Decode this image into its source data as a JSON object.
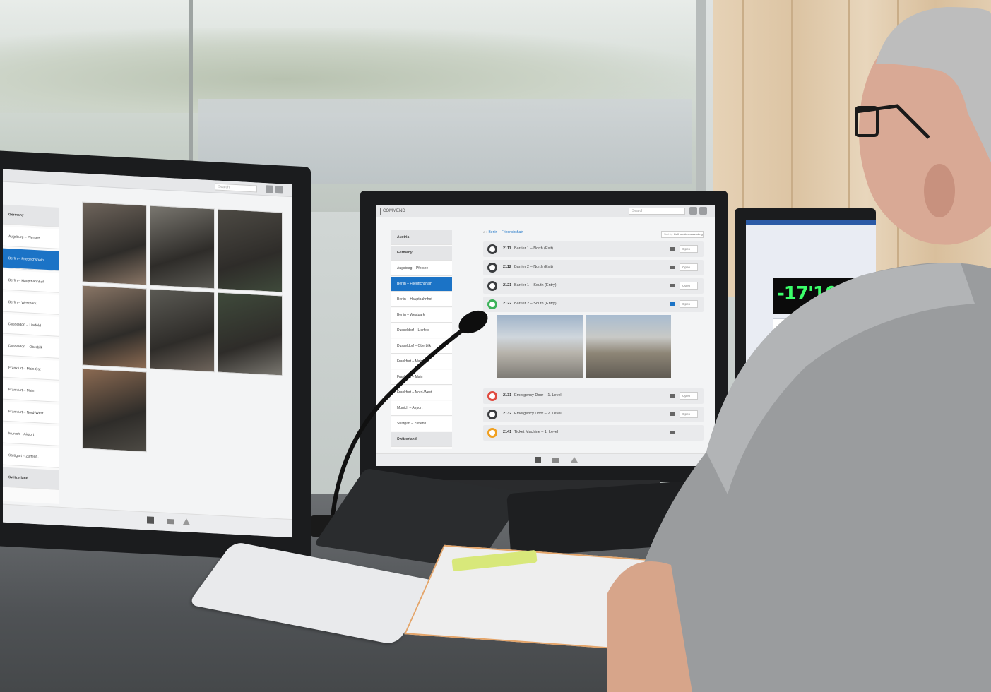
{
  "center_screen": {
    "logo": "COMMEND",
    "search_placeholder": "Search",
    "breadcrumb": "Berlin – Friedrichshain",
    "sort_label": "Sort by",
    "sort_value": "Call number ascending",
    "sidebar": [
      {
        "label": "Austria",
        "style": "hdr"
      },
      {
        "label": "Germany",
        "style": "hdr"
      },
      {
        "label": "Augsburg – Pfersee",
        "style": "normal"
      },
      {
        "label": "Berlin – Friedrichshain",
        "style": "active"
      },
      {
        "label": "Berlin – Hauptbahnhof",
        "style": "normal"
      },
      {
        "label": "Berlin – Westpark",
        "style": "normal"
      },
      {
        "label": "Dusseldorf – Lierfeld",
        "style": "normal"
      },
      {
        "label": "Dusseldorf – Oberbilk",
        "style": "normal"
      },
      {
        "label": "Frankfurt – Main Ost",
        "style": "normal"
      },
      {
        "label": "Frankfurt – Main",
        "style": "normal"
      },
      {
        "label": "Frankfurt – Nord-West",
        "style": "normal"
      },
      {
        "label": "Munich – Airport",
        "style": "normal"
      },
      {
        "label": "Stuttgart – Zuffenh.",
        "style": "normal"
      },
      {
        "label": "Switzerland",
        "style": "hdr"
      }
    ],
    "devices": [
      {
        "number": "2111",
        "label": "Barrier 1 – North (Exit)",
        "ring": "#3a3c3f",
        "select": "Open"
      },
      {
        "number": "2112",
        "label": "Barrier 2 – North (Exit)",
        "ring": "#3a3c3f",
        "select": "Open"
      },
      {
        "number": "2121",
        "label": "Barrier 1 – South (Entry)",
        "ring": "#3a3c3f",
        "select": "Open"
      },
      {
        "number": "2122",
        "label": "Barrier 2 – South (Entry)",
        "ring": "#3cb25a",
        "select": "Open"
      },
      {
        "number": "2131",
        "label": "Emergency Door – 1. Level",
        "ring": "#e04a3f",
        "select": "Open"
      },
      {
        "number": "2132",
        "label": "Emergency Door – 2. Level",
        "ring": "#3a3c3f",
        "select": "Open"
      },
      {
        "number": "2141",
        "label": "Ticket Machine – 1. Level",
        "ring": "#f0a020",
        "select": ""
      }
    ]
  },
  "left_screen": {
    "search_placeholder": "Search",
    "sidebar": [
      "Germany",
      "Augsburg – Pfersee",
      "Berlin – Friedrichshain",
      "Berlin – Hauptbahnhof",
      "Berlin – Westpark",
      "Dusseldorf – Lierfeld",
      "Dusseldorf – Oberbilk",
      "Frankfurt – Main Ost",
      "Frankfurt – Main",
      "Frankfurt – Nord-West",
      "Munich – Airport",
      "Stuttgart – Zuffenh.",
      "Switzerland"
    ]
  },
  "right_screen": {
    "weight_readout": "-17'100kg"
  },
  "colors": {
    "accent_blue": "#1b73c6",
    "status_green": "#3cb25a",
    "status_red": "#e04a3f",
    "status_orange": "#f0a020",
    "readout_green": "#3bff6a"
  }
}
